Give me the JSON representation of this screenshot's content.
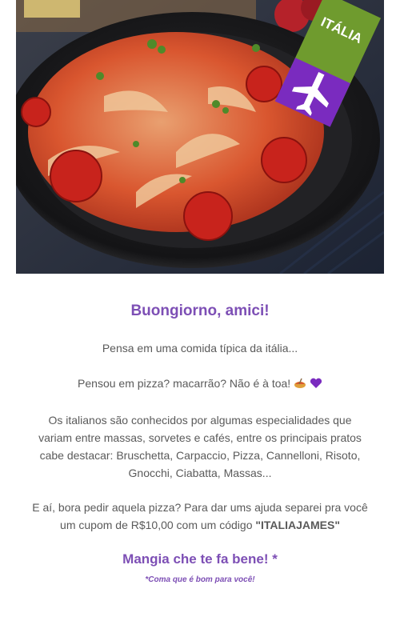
{
  "hero": {
    "tag_text": "ITÁLIA",
    "tag_color": "#6f9b2e",
    "tag_icon": "airplane-icon",
    "tag_icon_bg": "#7a2bbf"
  },
  "greeting": "Buongiorno, amici!",
  "paragraphs": {
    "p1": "Pensa em uma comida típica da itália...",
    "p2": "Pensou em pizza? macarrão? Não é à toa!",
    "p2_emojis": [
      "pasta-icon",
      "purple-heart-icon"
    ],
    "p3": "Os italianos são conhecidos por algumas especialidades que variam entre massas, sorvetes e cafés, entre os principais pratos cabe destacar: Bruschetta, Carpaccio, Pizza, Cannelloni, Risoto, Gnocchi, Ciabatta, Massas...",
    "p4_lead": "E aí, bora pedir aquela pizza? Para dar ums ajuda separei pra você um cupom de R$10,00 com um código ",
    "p4_code": "\"ITALIAJAMES\""
  },
  "closing": {
    "title": "Mangia che te fa bene! *",
    "subtitle": "*Coma que é bom para você!"
  },
  "colors": {
    "accent": "#7d4fb5",
    "text": "#5a5a5a"
  }
}
